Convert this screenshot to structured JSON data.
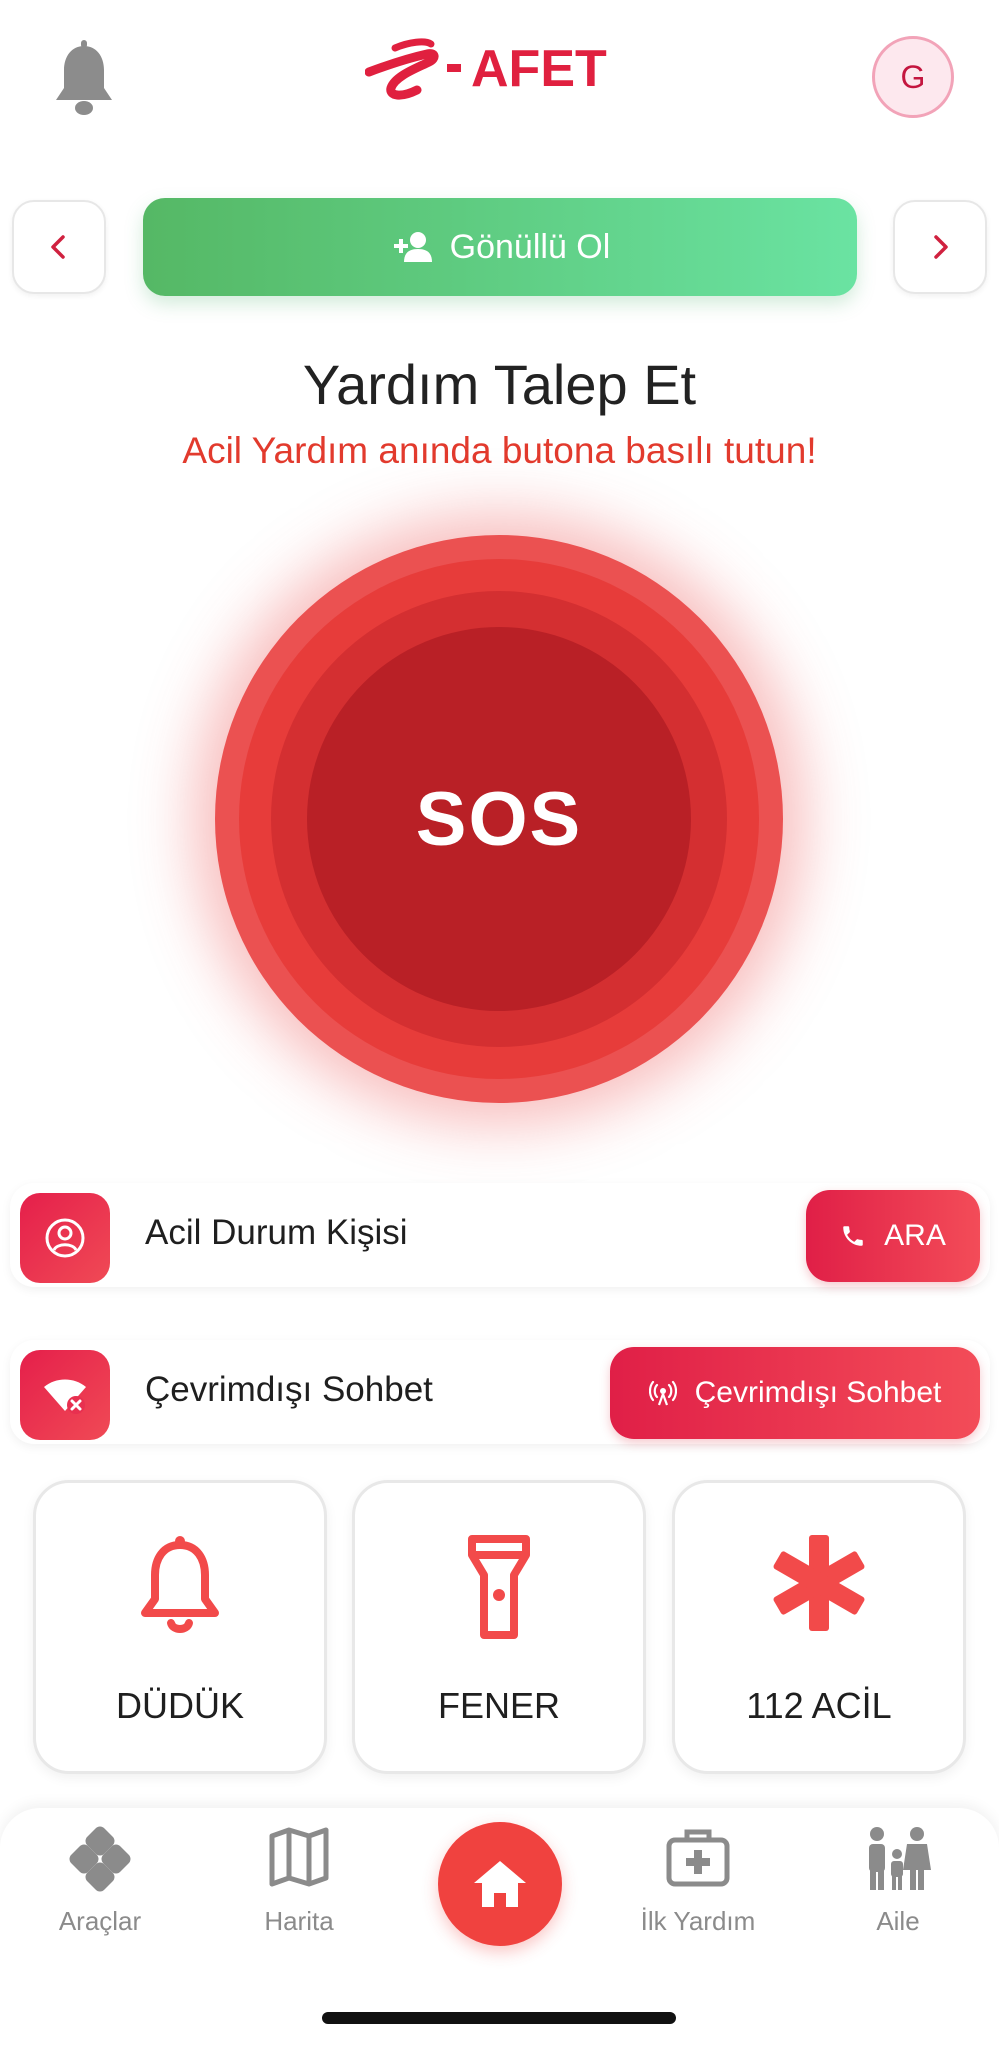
{
  "header": {
    "logo_text": "AFET",
    "avatar_initial": "G"
  },
  "carousel": {
    "volunteer_label": "Gönüllü Ol"
  },
  "main": {
    "title": "Yardım Talep Et",
    "subtitle": "Acil Yardım anında butona basılı tutun!",
    "sos_label": "SOS"
  },
  "rows": [
    {
      "label": "Acil Durum Kişisi",
      "button": "ARA",
      "icon": "person-circle-icon",
      "button_icon": "phone-icon"
    },
    {
      "label": "Çevrimdışı Sohbet",
      "button": "Çevrimdışı Sohbet",
      "icon": "wifi-off-icon",
      "button_icon": "broadcast-icon"
    }
  ],
  "tiles": [
    {
      "label": "DÜDÜK",
      "icon": "bell-icon"
    },
    {
      "label": "FENER",
      "icon": "flashlight-icon"
    },
    {
      "label": "112 ACİL",
      "icon": "asterisk-icon"
    }
  ],
  "bottom_nav": [
    {
      "label": "Araçlar",
      "icon": "tools-icon"
    },
    {
      "label": "Harita",
      "icon": "map-icon"
    },
    {
      "label": "",
      "icon": "home-icon"
    },
    {
      "label": "İlk Yardım",
      "icon": "first-aid-icon"
    },
    {
      "label": "Aile",
      "icon": "family-icon"
    }
  ],
  "colors": {
    "brand_red": "#e0203f",
    "sos_red": "#e73c3a",
    "volunteer_green": "#55b865",
    "nav_gray": "#8b8b8b"
  }
}
